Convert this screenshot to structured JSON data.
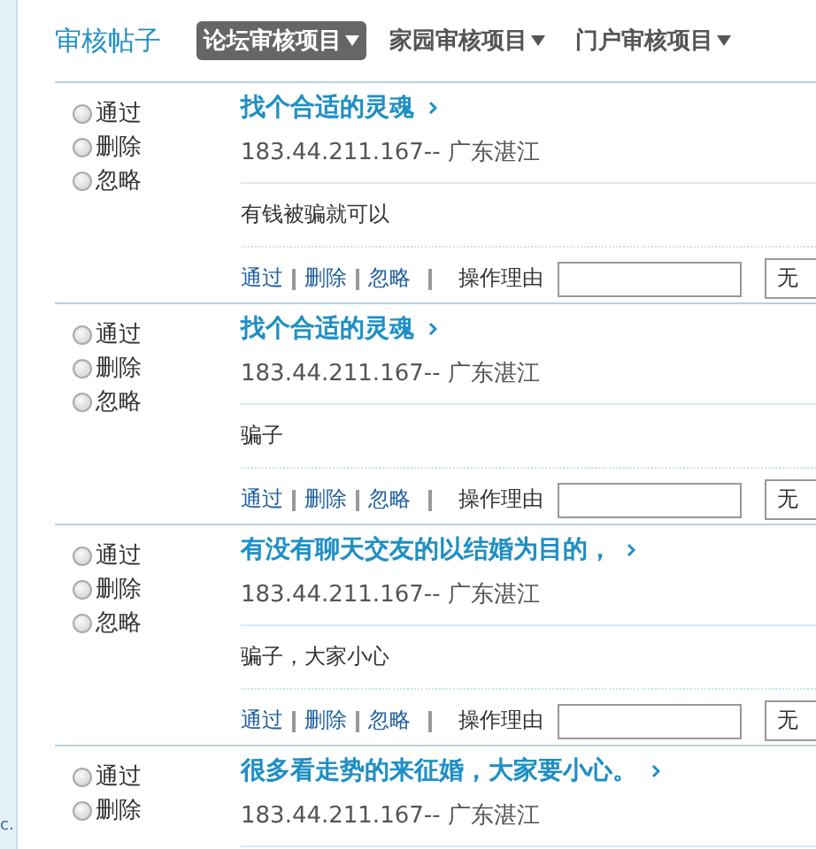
{
  "sidebar": {
    "fragment": "c."
  },
  "header": {
    "title": "审核帖子",
    "tabs": [
      {
        "label": "论坛审核项目",
        "selected": true
      },
      {
        "label": "家园审核项目",
        "selected": false
      },
      {
        "label": "门户审核项目",
        "selected": false
      }
    ]
  },
  "posts": [
    {
      "options": [
        {
          "label": "通过",
          "selected": false
        },
        {
          "label": "删除",
          "selected": false
        },
        {
          "label": "忽略",
          "selected": false
        }
      ],
      "title": "找个合适的灵魂",
      "source": "183.44.211.167-- 广东湛江",
      "content": "有钱被骗就可以",
      "actions": [
        "通过",
        "删除",
        "忽略"
      ],
      "reason_label": "操作理由",
      "reason_select": "无"
    },
    {
      "options": [
        {
          "label": "通过",
          "selected": false
        },
        {
          "label": "删除",
          "selected": false
        },
        {
          "label": "忽略",
          "selected": false
        }
      ],
      "title": "找个合适的灵魂",
      "source": "183.44.211.167-- 广东湛江",
      "content": "骗子",
      "actions": [
        "通过",
        "删除",
        "忽略"
      ],
      "reason_label": "操作理由",
      "reason_select": "无"
    },
    {
      "options": [
        {
          "label": "通过",
          "selected": false
        },
        {
          "label": "删除",
          "selected": false
        },
        {
          "label": "忽略",
          "selected": false
        }
      ],
      "title": "有没有聊天交友的以结婚为目的，",
      "source": "183.44.211.167-- 广东湛江",
      "content": "骗子，大家小心",
      "actions": [
        "通过",
        "删除",
        "忽略"
      ],
      "reason_label": "操作理由",
      "reason_select": "无"
    },
    {
      "options": [
        {
          "label": "通过",
          "selected": false
        },
        {
          "label": "删除",
          "selected": false
        }
      ],
      "title": "很多看走势的来征婚，大家要小心。",
      "source": "183.44.211.167-- 广东湛江"
    }
  ]
}
